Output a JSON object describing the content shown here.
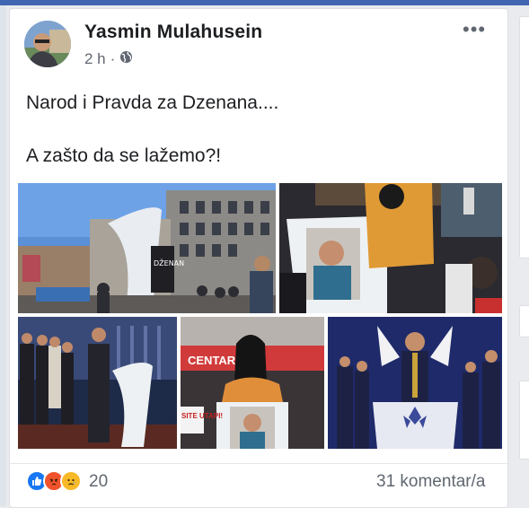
{
  "post": {
    "author": "Yasmin Mulahusein",
    "time": "2 h",
    "separator": "·",
    "privacy_icon": "globe-icon",
    "menu_icon": "more-dots-icon",
    "menu_label": "•••",
    "text_line_1": "Narod i Pravda za Dzenana....",
    "text_line_2": "A zašto da se lažemo?!",
    "photo_text": {
      "screen": "DŽENAN",
      "sign_1": "CENTAR",
      "sign_2": "SITE UTAPI!"
    }
  },
  "footer": {
    "reaction_icons": [
      "like-icon",
      "angry-icon",
      "sad-icon"
    ],
    "reaction_count": "20",
    "comments_label": "31 komentar/a"
  },
  "colors": {
    "brand_blue": "#4267b2",
    "like_blue": "#1877f2",
    "angry_orange": "#f0532c",
    "sad_yellow": "#f7b928",
    "text_secondary": "#606770"
  }
}
